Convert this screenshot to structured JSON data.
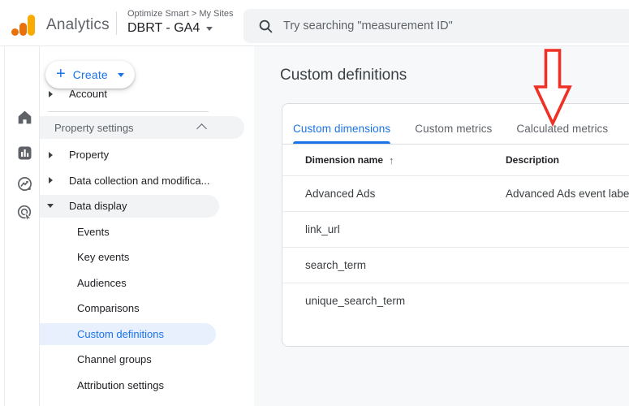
{
  "header": {
    "app_name": "Analytics",
    "breadcrumb": "Optimize Smart > My Sites",
    "property_name": "DBRT - GA4",
    "search_placeholder": "Try searching \"measurement ID\""
  },
  "rail": {
    "items": [
      "home",
      "reports",
      "explore",
      "advertising"
    ]
  },
  "sidebar": {
    "create_label": "Create",
    "account_label": "Account",
    "section_label": "Property settings",
    "items": [
      {
        "label": "Property",
        "level": 1,
        "expand": "collapsed"
      },
      {
        "label": "Data collection and modifica...",
        "level": 1,
        "expand": "collapsed"
      },
      {
        "label": "Data display",
        "level": 1,
        "expand": "expanded",
        "highlight": true
      },
      {
        "label": "Events",
        "level": 2
      },
      {
        "label": "Key events",
        "level": 2
      },
      {
        "label": "Audiences",
        "level": 2
      },
      {
        "label": "Comparisons",
        "level": 2
      },
      {
        "label": "Custom definitions",
        "level": 2,
        "selected": true
      },
      {
        "label": "Channel groups",
        "level": 2
      },
      {
        "label": "Attribution settings",
        "level": 2
      }
    ]
  },
  "main": {
    "title": "Custom definitions",
    "tabs": [
      {
        "label": "Custom dimensions",
        "active": true
      },
      {
        "label": "Custom metrics",
        "active": false
      },
      {
        "label": "Calculated metrics",
        "active": false
      }
    ],
    "table": {
      "columns": [
        {
          "label": "Dimension name",
          "sort": "asc"
        },
        {
          "label": "Description",
          "sort": null
        }
      ],
      "rows": [
        {
          "name": "Advanced Ads",
          "description": "Advanced Ads event label"
        },
        {
          "name": "link_url",
          "description": ""
        },
        {
          "name": "search_term",
          "description": ""
        },
        {
          "name": "unique_search_term",
          "description": ""
        }
      ]
    },
    "annotation": {
      "type": "red-arrow",
      "points_at": "Calculated metrics"
    }
  },
  "colors": {
    "accent_blue": "#1a73e8",
    "selected_item_bg": "#e8f0fe",
    "pill_gray": "#f1f3f4",
    "annotation_red": "#ee3124",
    "logo_amber": "#f9ab00",
    "logo_orange": "#e8710a"
  }
}
